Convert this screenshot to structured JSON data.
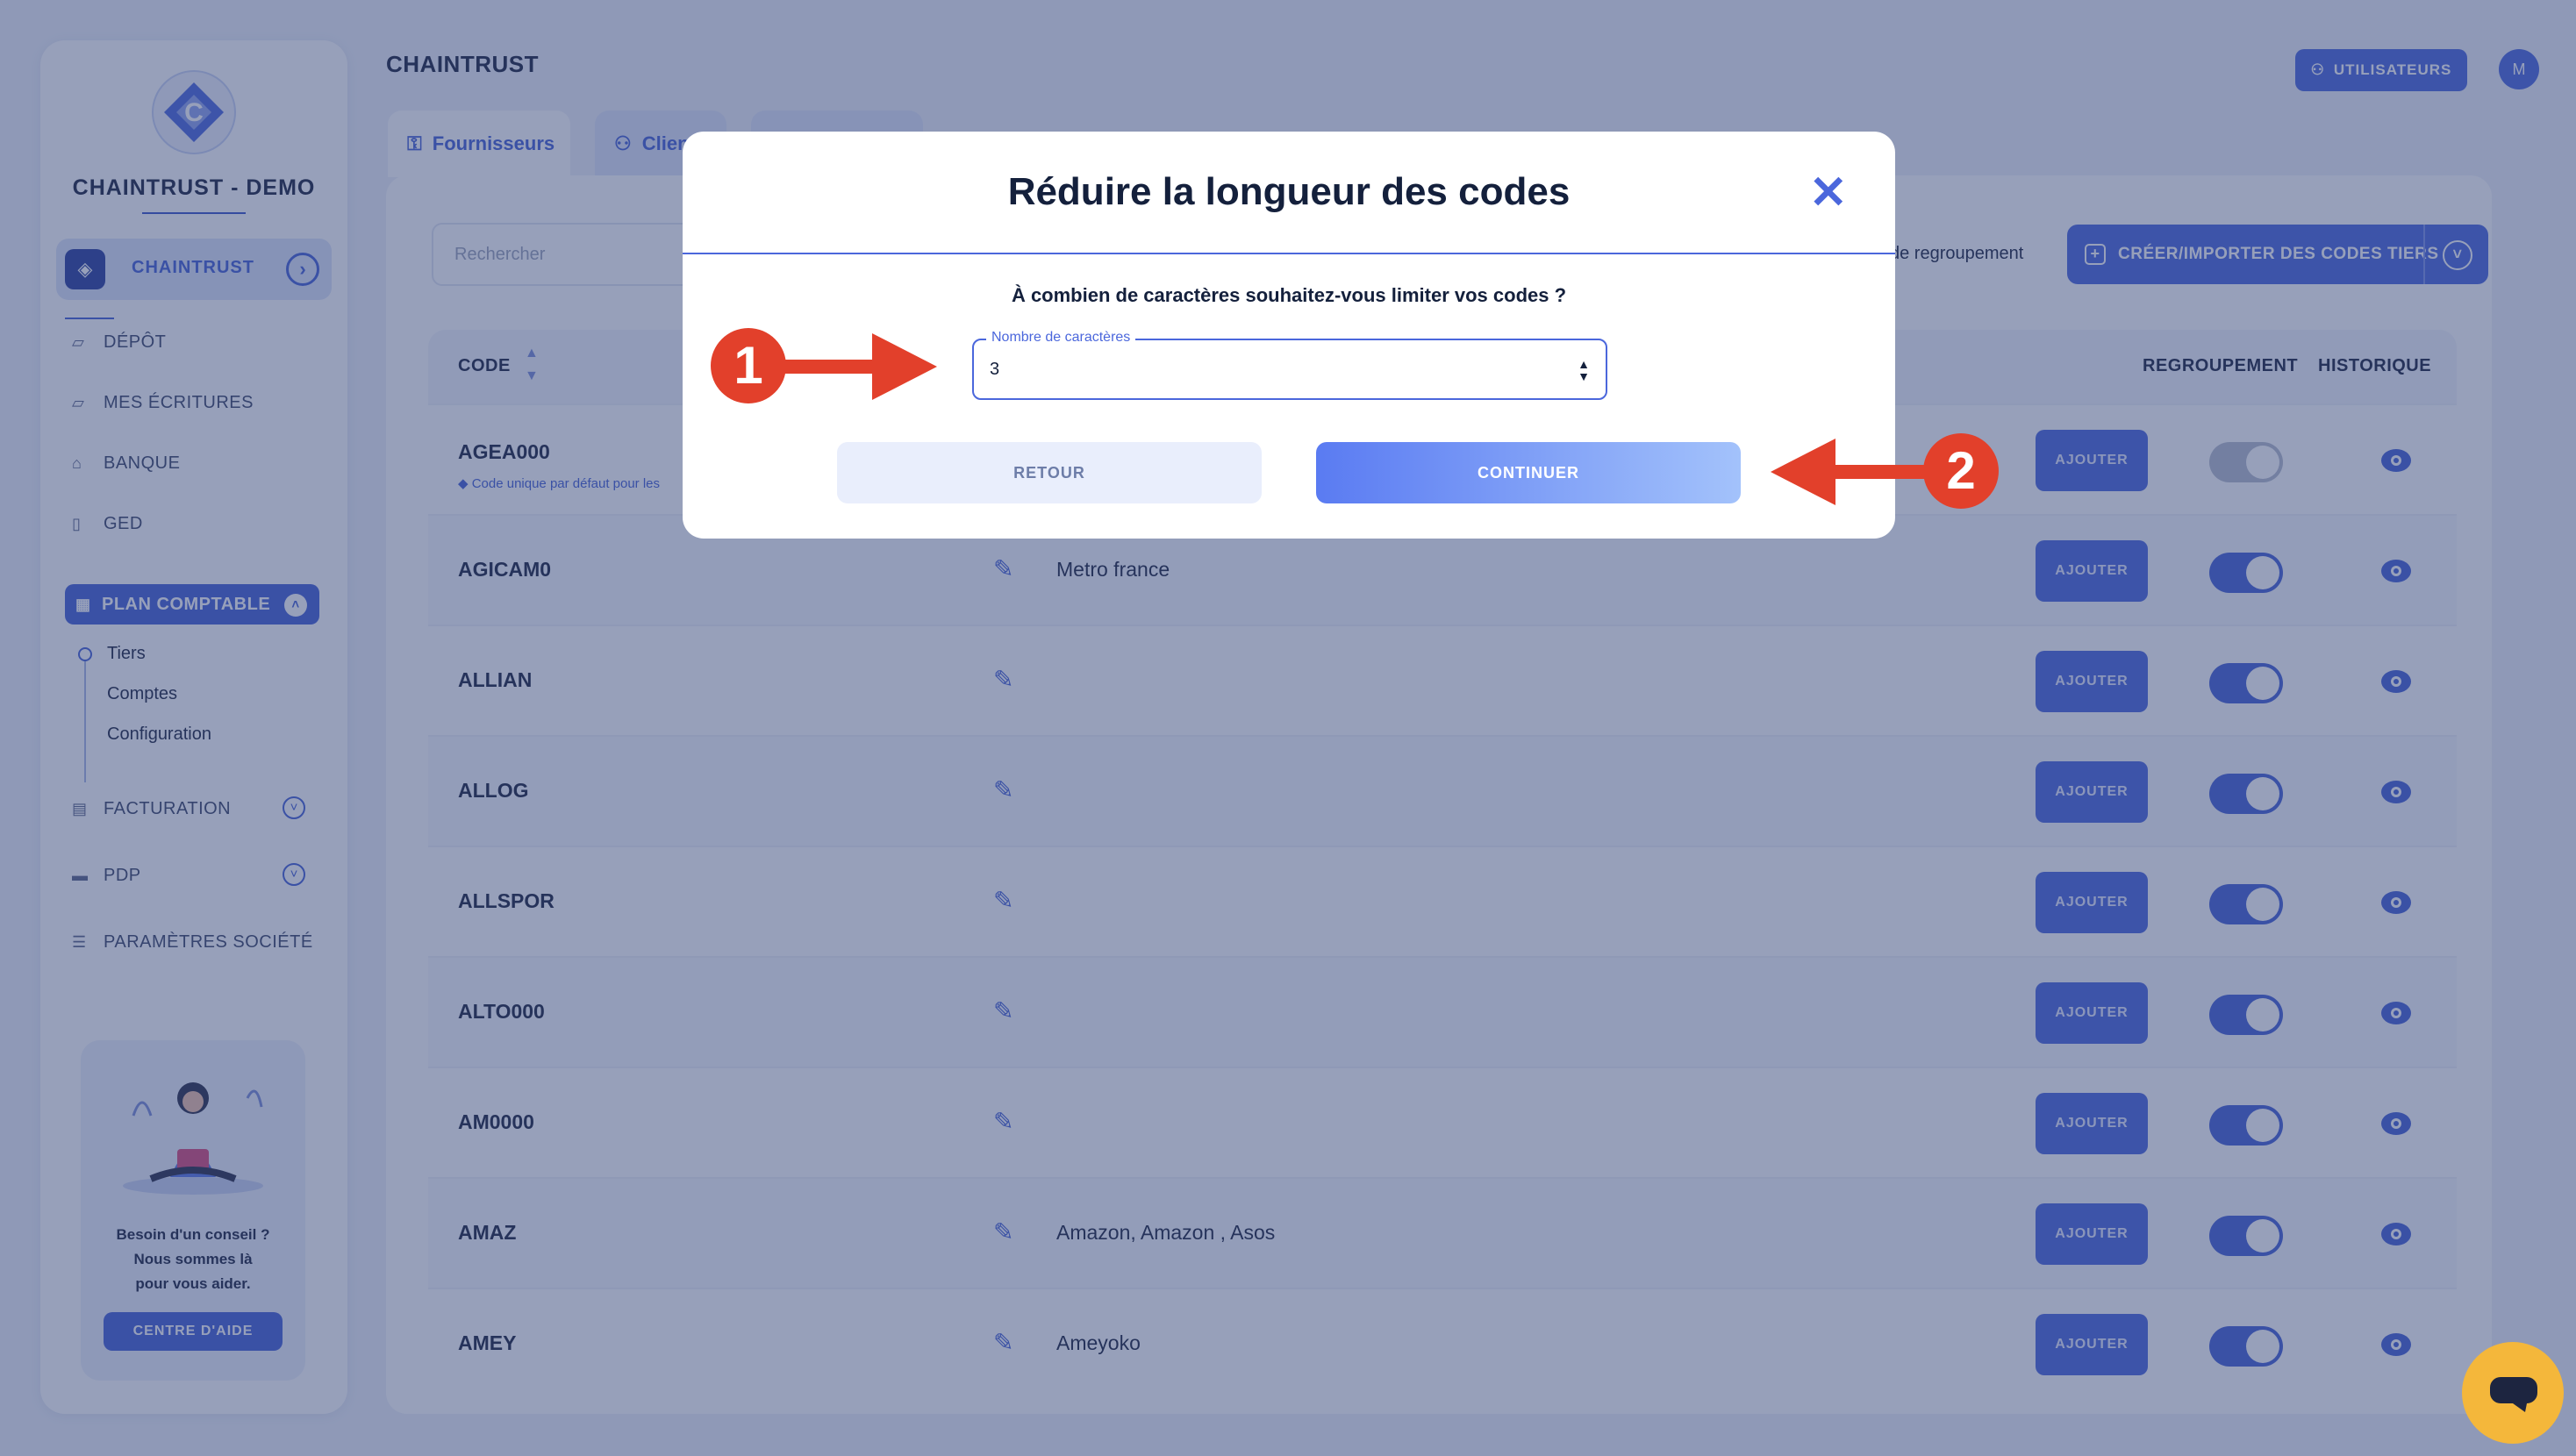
{
  "sidebar": {
    "company": "CHAINTRUST - DEMO",
    "active_org": "CHAINTRUST",
    "nav": [
      {
        "icon": "folder-icon",
        "label": "DÉPÔT"
      },
      {
        "icon": "folder-icon",
        "label": "MES ÉCRITURES"
      },
      {
        "icon": "bank-icon",
        "label": "BANQUE"
      },
      {
        "icon": "document-icon",
        "label": "GED"
      }
    ],
    "plan": "PLAN COMPTABLE",
    "plan_sub": [
      "Tiers",
      "Comptes",
      "Configuration"
    ],
    "nav_bottom": [
      {
        "icon": "invoice-icon",
        "label": "FACTURATION"
      },
      {
        "icon": "card-icon",
        "label": "PDP"
      },
      {
        "icon": "sliders-icon",
        "label": "PARAMÈTRES SOCIÉTÉ"
      }
    ],
    "help": {
      "line1": "Besoin d'un conseil ?",
      "line2": "Nous sommes là",
      "line3": "pour vous aider.",
      "button": "CENTRE D'AIDE"
    }
  },
  "header": {
    "title": "CHAINTRUST",
    "users_button": "UTILISATEURS",
    "avatar": "M"
  },
  "tabs": [
    "Fournisseurs",
    "Clien"
  ],
  "toolbar": {
    "search_placeholder": "Rechercher",
    "grouping_text": "de regroupement",
    "create_button": "CRÉER/IMPORTER DES CODES TIERS"
  },
  "table": {
    "headers": {
      "code": "CODE",
      "grouping": "REGROUPEMENT",
      "history": "HISTORIQUE"
    },
    "add_label": "AJOUTER",
    "first_note": "Code unique par défaut pour les",
    "rows": [
      {
        "code": "AGEA000",
        "label": "",
        "grouping_on": false
      },
      {
        "code": "AGICAM0",
        "label": "Metro france",
        "grouping_on": true
      },
      {
        "code": "ALLIAN",
        "label": "",
        "grouping_on": true
      },
      {
        "code": "ALLOG",
        "label": "",
        "grouping_on": true
      },
      {
        "code": "ALLSPOR",
        "label": "",
        "grouping_on": true
      },
      {
        "code": "ALTO000",
        "label": "",
        "grouping_on": true
      },
      {
        "code": "AM0000",
        "label": "",
        "grouping_on": true
      },
      {
        "code": "AMAZ",
        "label": "Amazon, Amazon , Asos",
        "grouping_on": true
      },
      {
        "code": "AMEY",
        "label": "Ameyoko",
        "grouping_on": true
      }
    ]
  },
  "modal": {
    "title": "Réduire la longueur des codes",
    "question": "À combien de caractères souhaitez-vous limiter vos codes ?",
    "field_label": "Nombre de caractères",
    "field_value": "3",
    "back": "RETOUR",
    "continue": "CONTINUER"
  },
  "annotations": {
    "step1": "1",
    "step2": "2",
    "color": "#e2402b"
  },
  "colors": {
    "accent": "#4b67dc",
    "overlay": "rgba(48,66,118,0.5)",
    "chat": "#f4b73b"
  }
}
